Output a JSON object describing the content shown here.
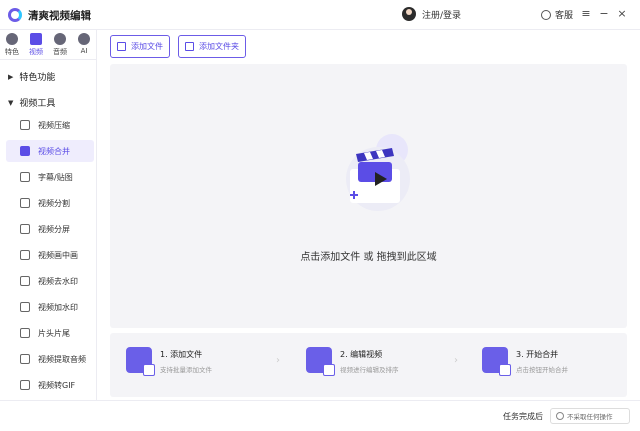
{
  "titlebar": {
    "app_title": "清爽视频编辑",
    "login_label": "注册/登录",
    "service_label": "客服",
    "menu_icon": "≡",
    "minimize_icon": "−",
    "close_icon": "×"
  },
  "sidebar": {
    "modes": [
      {
        "label": "特色",
        "icon": "star-icon"
      },
      {
        "label": "视频",
        "icon": "video-icon"
      },
      {
        "label": "音频",
        "icon": "audio-icon"
      },
      {
        "label": "AI",
        "icon": "ai-icon"
      }
    ],
    "sections": [
      {
        "label": "特色功能"
      },
      {
        "label": "视频工具"
      }
    ],
    "tools": [
      {
        "label": "视频压缩"
      },
      {
        "label": "视频合并"
      },
      {
        "label": "字幕/贴图"
      },
      {
        "label": "视频分割"
      },
      {
        "label": "视频分屏"
      },
      {
        "label": "视频画中画"
      },
      {
        "label": "视频去水印"
      },
      {
        "label": "视频加水印"
      },
      {
        "label": "片头片尾"
      },
      {
        "label": "视频提取音频"
      },
      {
        "label": "视频转GIF"
      }
    ]
  },
  "toolbar": {
    "add_file": "添加文件",
    "add_folder": "添加文件夹"
  },
  "dropzone": {
    "text": "点击添加文件 或 拖拽到此区域"
  },
  "steps": [
    {
      "title": "1. 添加文件",
      "subtitle": "支持批量添加文件"
    },
    {
      "title": "2. 编辑视频",
      "subtitle": "视频进行编辑及排序"
    },
    {
      "title": "3. 开始合并",
      "subtitle": "点击按钮开始合并"
    }
  ],
  "footer": {
    "after_label": "任务完成后",
    "after_value": "不采取任何操作"
  },
  "colors": {
    "accent": "#5b4de6",
    "panel": "#f4f4f7"
  }
}
